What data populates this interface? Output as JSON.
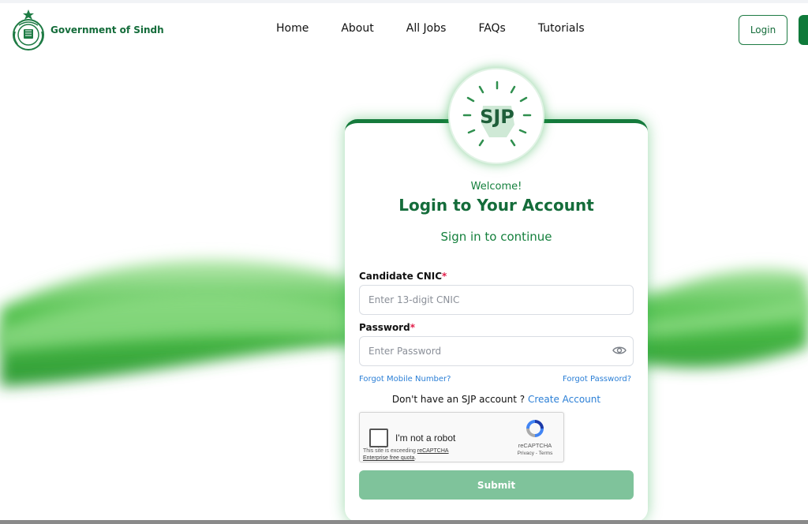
{
  "header": {
    "brand_name": "Government of Sindh",
    "nav": [
      {
        "label": "Home"
      },
      {
        "label": "About"
      },
      {
        "label": "All Jobs"
      },
      {
        "label": "FAQs"
      },
      {
        "label": "Tutorials"
      }
    ],
    "login_label": "Login"
  },
  "card": {
    "logo_text": "SJP",
    "welcome": "Welcome!",
    "title": "Login to Your Account",
    "subtitle": "Sign in to continue",
    "cnic": {
      "label": "Candidate CNIC",
      "required_mark": "*",
      "placeholder": "Enter 13-digit CNIC",
      "value": ""
    },
    "password": {
      "label": "Password",
      "required_mark": "*",
      "placeholder": "Enter Password",
      "value": ""
    },
    "forgot_mobile": "Forgot Mobile Number?",
    "forgot_password": "Forgot Password?",
    "no_account_text": "Don't have an SJP account ?",
    "create_account": "Create Account",
    "captcha": {
      "label": "I'm not a robot",
      "notice_prefix": "This site is exceeding",
      "notice_link": "reCAPTCHA Enterprise free quota",
      "notice_suffix": ".",
      "brand": "reCAPTCHA",
      "terms": "Privacy - Terms"
    },
    "submit_label": "Submit"
  },
  "colors": {
    "brand_green": "#146c3a",
    "accent_green": "#15803d",
    "link_blue": "#2b7fd6",
    "submit_bg": "#7fc39b",
    "required_red": "#e11d48"
  },
  "icons": [
    "sindh-emblem-icon",
    "sjp-logo-icon",
    "eye-icon",
    "recaptcha-icon"
  ]
}
